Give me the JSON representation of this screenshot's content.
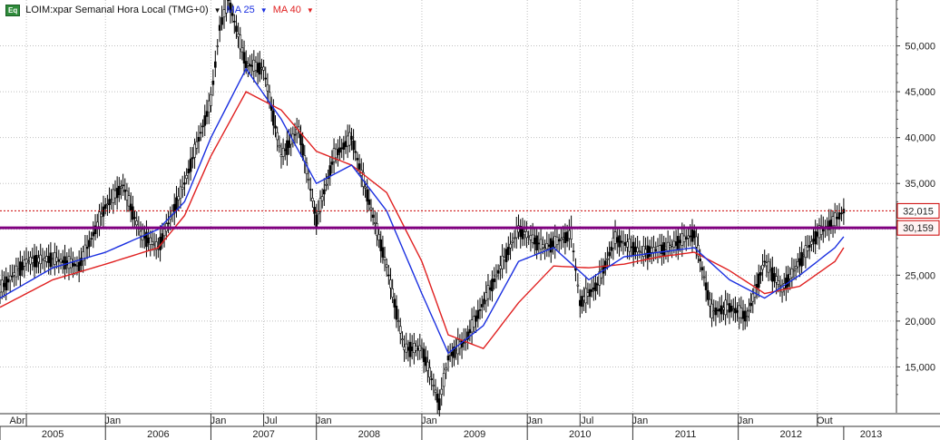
{
  "legend": {
    "badge": "Eq",
    "symbol": "LOIM:xpar Semanal Hora Local (TMG+0)",
    "ma25": "MA 25",
    "ma40": "MA 40"
  },
  "colors": {
    "candle": "#000000",
    "ma25": "#1a2fe0",
    "ma40": "#e02020",
    "support_line": "#800080",
    "last_price_line": "#cc0000",
    "grid": "#c0c0c0",
    "axis_bg": "#ffffff"
  },
  "chart_data": {
    "type": "line",
    "title": "LOIM:xpar Semanal Hora Local (TMG+0)",
    "y_ticks": [
      "15,000",
      "20,000",
      "25,000",
      "30,000",
      "35,000",
      "40,000",
      "45,000",
      "50,000"
    ],
    "ylim": [
      10000,
      55000
    ],
    "grid": true,
    "x_months": [
      "Abr",
      "Jan",
      "Jan",
      "Jul",
      "Jan",
      "Jan",
      "Jan",
      "Jul",
      "Jan",
      "Jan",
      "Out"
    ],
    "x_years": [
      "2005",
      "2006",
      "2007",
      "2008",
      "2009",
      "2010",
      "2011",
      "2012",
      "2013"
    ],
    "markers": [
      {
        "label": "32,015",
        "value": 32015,
        "style": "dotted"
      },
      {
        "label": "30,159",
        "value": 30159,
        "style": "solid"
      }
    ],
    "series": [
      {
        "name": "LOIM:xpar",
        "points": [
          [
            "2005-01",
            23500
          ],
          [
            "2005-04",
            26500
          ],
          [
            "2005-07",
            26800
          ],
          [
            "2005-10",
            26000
          ],
          [
            "2006-01",
            32500
          ],
          [
            "2006-03",
            34800
          ],
          [
            "2006-05",
            29500
          ],
          [
            "2006-07",
            28000
          ],
          [
            "2006-10",
            35000
          ],
          [
            "2007-01",
            44000
          ],
          [
            "2007-02",
            52000
          ],
          [
            "2007-03",
            55000
          ],
          [
            "2007-05",
            48000
          ],
          [
            "2007-07",
            47500
          ],
          [
            "2007-09",
            38000
          ],
          [
            "2007-11",
            41000
          ],
          [
            "2008-01",
            31000
          ],
          [
            "2008-03",
            38000
          ],
          [
            "2008-05",
            40000
          ],
          [
            "2008-07",
            33000
          ],
          [
            "2008-09",
            26000
          ],
          [
            "2008-11",
            17000
          ],
          [
            "2009-01",
            17000
          ],
          [
            "2009-03",
            11000
          ],
          [
            "2009-04",
            16000
          ],
          [
            "2009-06",
            18000
          ],
          [
            "2009-09",
            24000
          ],
          [
            "2009-12",
            30000
          ],
          [
            "2010-03",
            28000
          ],
          [
            "2010-06",
            29500
          ],
          [
            "2010-07",
            22000
          ],
          [
            "2010-09",
            24000
          ],
          [
            "2010-11",
            29000
          ],
          [
            "2011-02",
            27500
          ],
          [
            "2011-05",
            28000
          ],
          [
            "2011-08",
            29500
          ],
          [
            "2011-10",
            21000
          ],
          [
            "2011-12",
            21500
          ],
          [
            "2012-02",
            20500
          ],
          [
            "2012-04",
            26500
          ],
          [
            "2012-06",
            23500
          ],
          [
            "2012-08",
            26500
          ],
          [
            "2012-10",
            29500
          ],
          [
            "2012-12",
            31000
          ],
          [
            "2013-01",
            32015
          ]
        ]
      },
      {
        "name": "MA 25",
        "points": [
          [
            "2005-01",
            22500
          ],
          [
            "2005-07",
            25800
          ],
          [
            "2006-01",
            27500
          ],
          [
            "2006-07",
            30000
          ],
          [
            "2006-10",
            33000
          ],
          [
            "2007-01",
            40000
          ],
          [
            "2007-05",
            47500
          ],
          [
            "2007-09",
            42000
          ],
          [
            "2008-01",
            35000
          ],
          [
            "2008-05",
            37000
          ],
          [
            "2008-09",
            32000
          ],
          [
            "2009-01",
            23000
          ],
          [
            "2009-04",
            16500
          ],
          [
            "2009-08",
            19500
          ],
          [
            "2009-12",
            26500
          ],
          [
            "2010-04",
            28000
          ],
          [
            "2010-08",
            24500
          ],
          [
            "2010-12",
            27000
          ],
          [
            "2011-04",
            27500
          ],
          [
            "2011-08",
            28000
          ],
          [
            "2011-12",
            24500
          ],
          [
            "2012-04",
            22500
          ],
          [
            "2012-08",
            25000
          ],
          [
            "2012-12",
            28000
          ],
          [
            "2013-01",
            29200
          ]
        ]
      },
      {
        "name": "MA 40",
        "points": [
          [
            "2005-01",
            21500
          ],
          [
            "2005-07",
            24500
          ],
          [
            "2006-01",
            26200
          ],
          [
            "2006-07",
            28000
          ],
          [
            "2006-10",
            31500
          ],
          [
            "2007-01",
            38000
          ],
          [
            "2007-05",
            45000
          ],
          [
            "2007-09",
            43000
          ],
          [
            "2008-01",
            38500
          ],
          [
            "2008-05",
            37000
          ],
          [
            "2008-09",
            34000
          ],
          [
            "2009-01",
            26500
          ],
          [
            "2009-04",
            18500
          ],
          [
            "2009-08",
            17000
          ],
          [
            "2009-12",
            22000
          ],
          [
            "2010-04",
            26000
          ],
          [
            "2010-08",
            25800
          ],
          [
            "2010-12",
            26200
          ],
          [
            "2011-04",
            27000
          ],
          [
            "2011-08",
            27500
          ],
          [
            "2011-12",
            25500
          ],
          [
            "2012-04",
            23000
          ],
          [
            "2012-08",
            23800
          ],
          [
            "2012-12",
            26500
          ],
          [
            "2013-01",
            28000
          ]
        ]
      }
    ]
  }
}
